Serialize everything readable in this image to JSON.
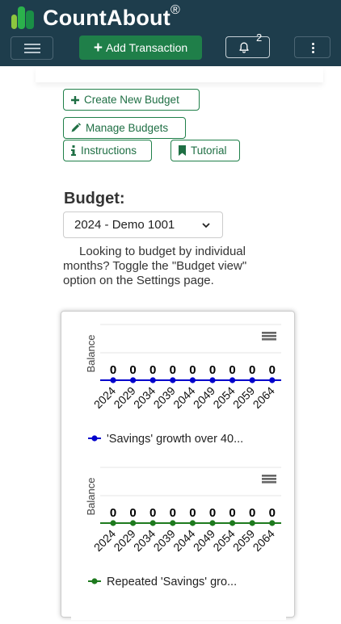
{
  "header": {
    "brand": "CountAbout",
    "brand_mark": "®",
    "add_transaction_label": "Add Transaction",
    "notification_count": "2",
    "colors": {
      "bar": "#1e3d4c",
      "accent": "#1f7f49"
    }
  },
  "actions": {
    "create_budget": "Create New Budget",
    "manage_budgets": "Manage Budgets",
    "instructions": "Instructions",
    "tutorial": "Tutorial"
  },
  "budget": {
    "heading": "Budget:",
    "selected": "2024 - Demo 1001",
    "info": "Looking to budget by individual months? Toggle the \"Budget view\" option on the Settings page."
  },
  "chart_data": [
    {
      "type": "line",
      "ylabel": "Balance",
      "x": [
        "2024",
        "2029",
        "2034",
        "2039",
        "2044",
        "2049",
        "2054",
        "2059",
        "2064"
      ],
      "series": [
        {
          "name": "'Savings' growth over 40...",
          "values": [
            0,
            0,
            0,
            0,
            0,
            0,
            0,
            0,
            0
          ],
          "color": "#0000cc"
        }
      ],
      "data_labels": true,
      "legend": "bottom"
    },
    {
      "type": "line",
      "ylabel": "Balance",
      "x": [
        "2024",
        "2029",
        "2034",
        "2039",
        "2044",
        "2049",
        "2054",
        "2059",
        "2064"
      ],
      "series": [
        {
          "name": "Repeated 'Savings' gro...",
          "values": [
            0,
            0,
            0,
            0,
            0,
            0,
            0,
            0,
            0
          ],
          "color": "#1e7a1e"
        }
      ],
      "data_labels": true,
      "legend": "bottom"
    }
  ]
}
